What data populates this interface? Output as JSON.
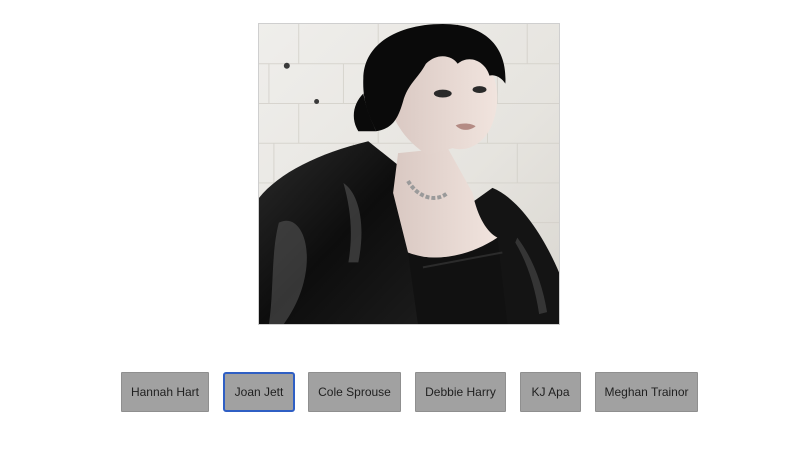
{
  "quiz": {
    "options": [
      {
        "label": "Hannah Hart"
      },
      {
        "label": "Joan Jett"
      },
      {
        "label": "Cole Sprouse"
      },
      {
        "label": "Debbie Harry"
      },
      {
        "label": "KJ Apa"
      },
      {
        "label": "Meghan Trainor"
      }
    ],
    "focused_option": "Joan Jett"
  },
  "colors": {
    "button_bg": "#a1a1a1",
    "focus_ring": "#2f5fc4",
    "page_bg": "#ffffff"
  }
}
